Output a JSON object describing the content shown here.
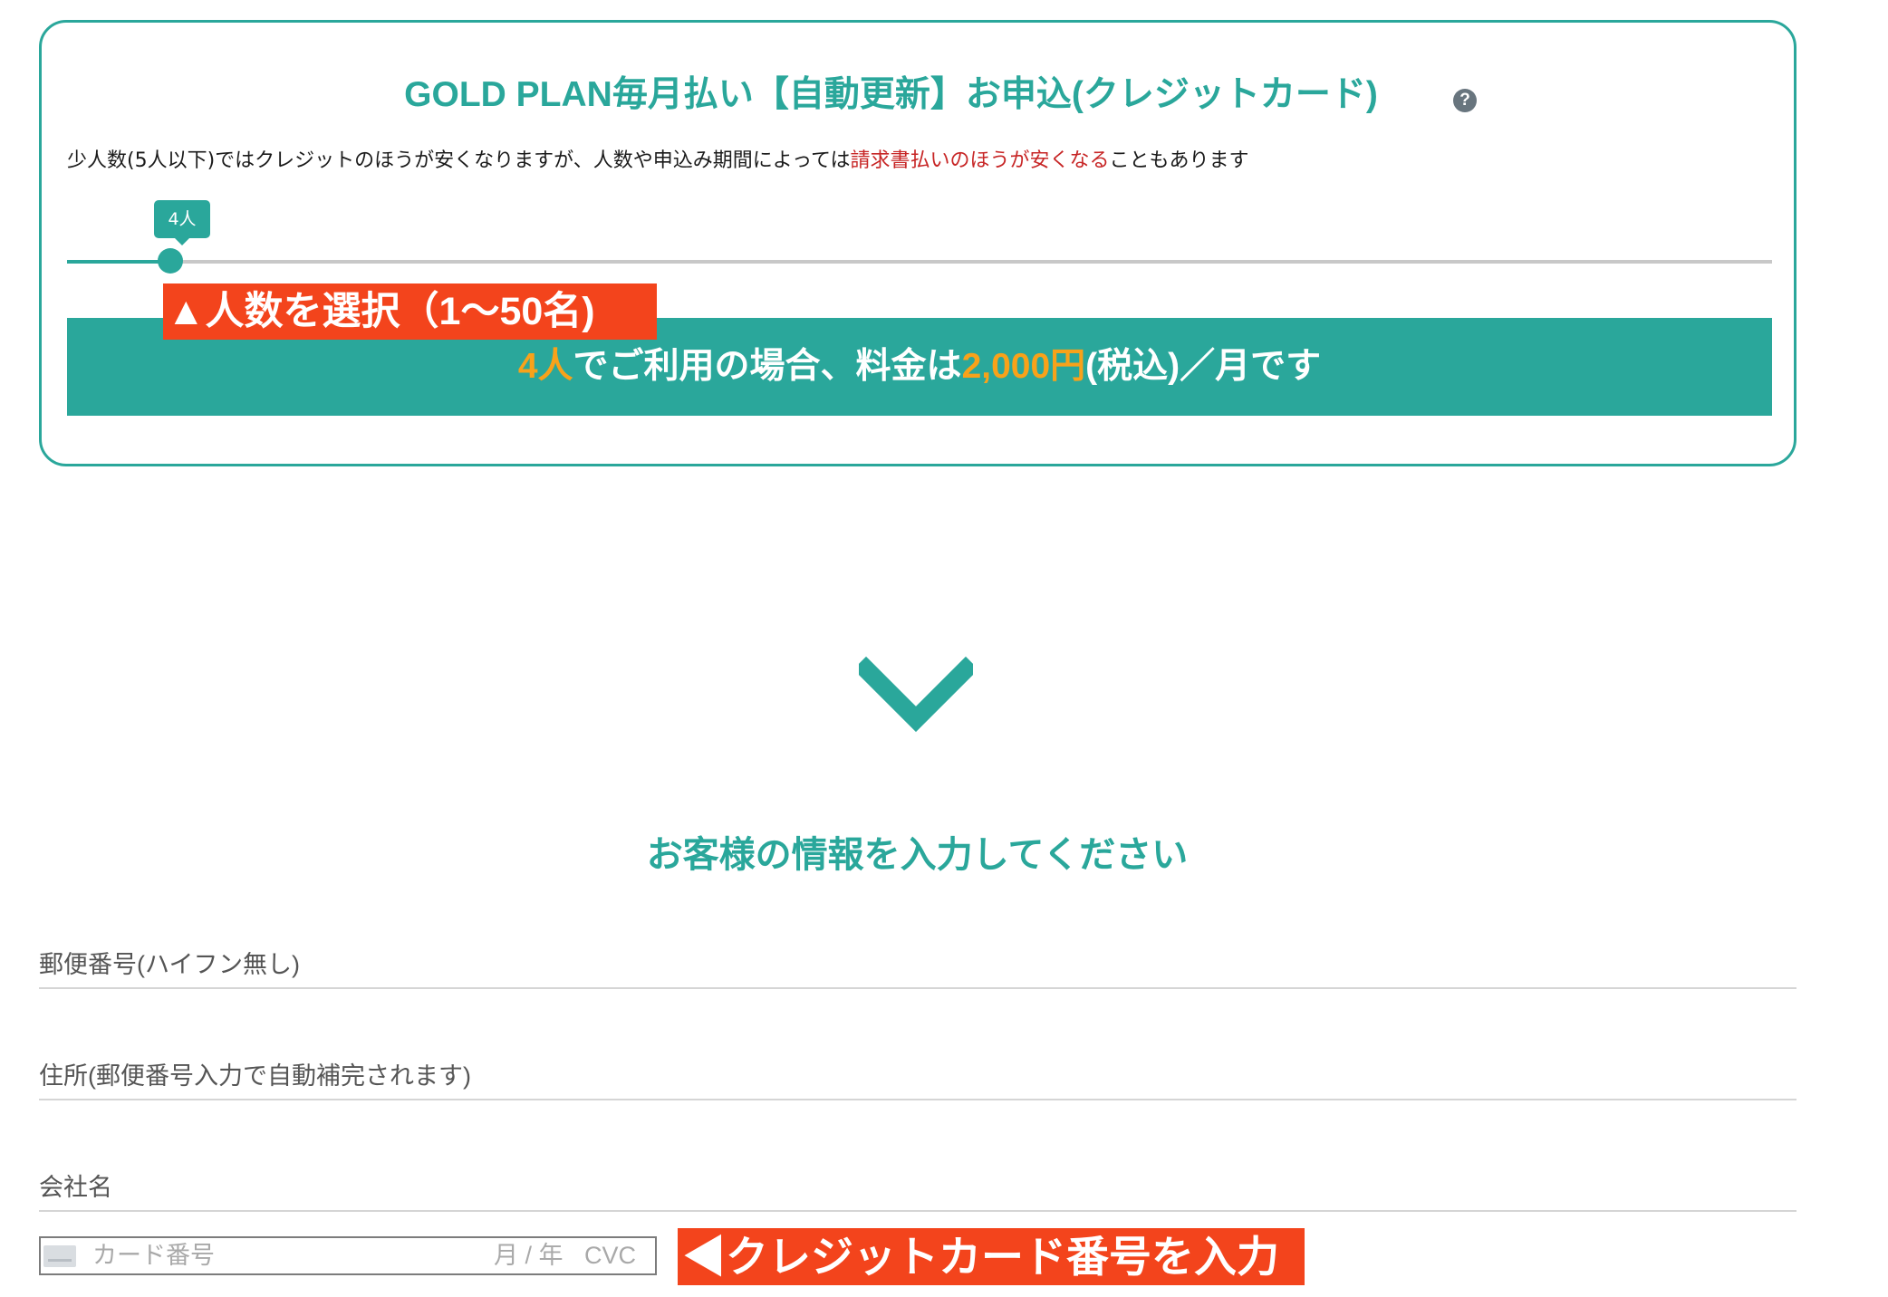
{
  "plan": {
    "title": "GOLD PLAN毎月払い【自動更新】お申込(クレジットカード)",
    "help_icon": "question-circle-icon",
    "note_prefix": "少人数(5人以下)ではクレジットのほうが安くなりますが、人数や申込み期間によっては",
    "note_highlight": "請求書払いのほうが安くなる",
    "note_suffix": "こともあります"
  },
  "slider": {
    "tooltip": "4人",
    "value": 4,
    "min": 1,
    "max": 50
  },
  "price": {
    "people": "4人",
    "middle": "でご利用の場合、料金は",
    "amount": "2,000円",
    "suffix": "(税込)／月です"
  },
  "annotations": {
    "count": "▲人数を選択（1〜50名)",
    "card": "◀クレジットカード番号を入力"
  },
  "customer": {
    "heading": "お客様の情報を入力してください",
    "postal_placeholder": "郵便番号(ハイフン無し)",
    "address_placeholder": "住所(郵便番号入力で自動補完されます)",
    "company_placeholder": "会社名"
  },
  "card": {
    "icon": "credit-card-icon",
    "number_placeholder": "カード番号",
    "exp_placeholder": "月 / 年",
    "cvc_placeholder": "CVC"
  },
  "colors": {
    "accent": "#2aa79b",
    "annotation": "#f3441c",
    "price_highlight": "#f8a21a",
    "note_red": "#c72525"
  }
}
